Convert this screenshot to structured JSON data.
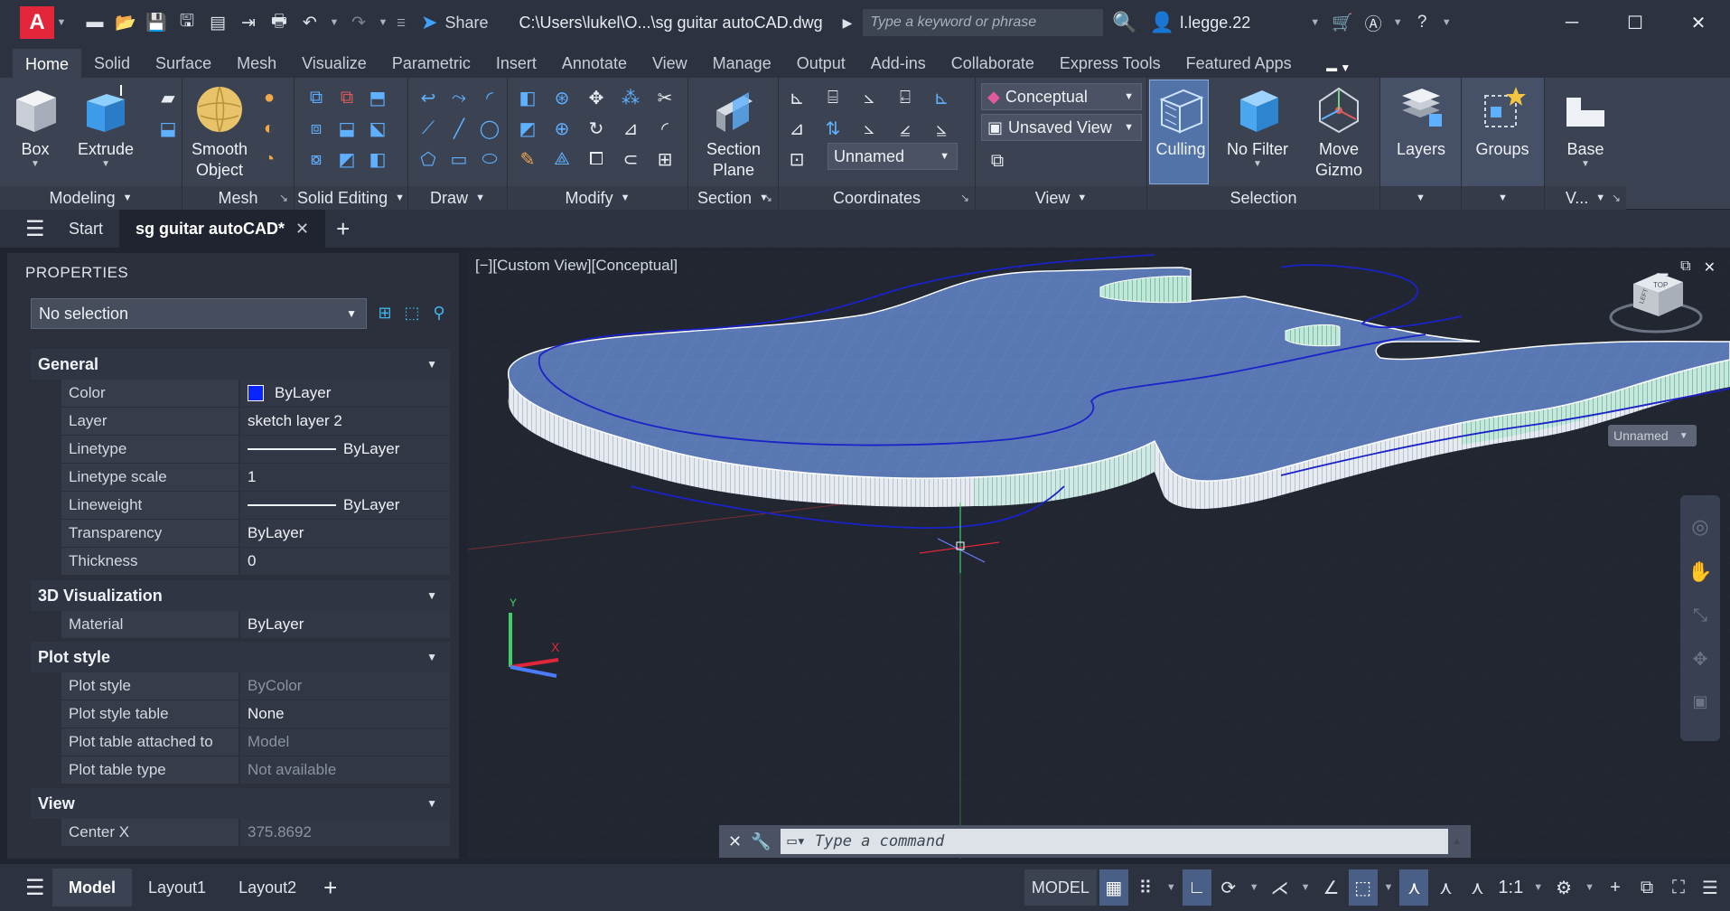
{
  "titlebar": {
    "logo": "A",
    "share": "Share",
    "filepath": "C:\\Users\\lukel\\O...\\sg guitar autoCAD.dwg",
    "search_placeholder": "Type a keyword or phrase",
    "user": "l.legge.22",
    "icons": [
      "new-icon",
      "open-icon",
      "save-icon",
      "save-as-icon",
      "print-preview-icon",
      "import-icon",
      "plot-icon",
      "undo-icon",
      "redo-icon",
      "workspace-icon"
    ]
  },
  "ribbon_tabs": [
    "Home",
    "Solid",
    "Surface",
    "Mesh",
    "Visualize",
    "Parametric",
    "Insert",
    "Annotate",
    "View",
    "Manage",
    "Output",
    "Add-ins",
    "Collaborate",
    "Express Tools",
    "Featured Apps"
  ],
  "ribbon": {
    "modeling": {
      "title": "Modeling",
      "box": "Box",
      "extrude": "Extrude"
    },
    "mesh": {
      "title": "Mesh",
      "smooth": "Smooth Object"
    },
    "solid_editing": {
      "title": "Solid Editing"
    },
    "draw": {
      "title": "Draw"
    },
    "modify": {
      "title": "Modify"
    },
    "section": {
      "title": "Section",
      "plane": "Section Plane"
    },
    "coordinates": {
      "title": "Coordinates",
      "ucs": "Unnamed"
    },
    "view": {
      "title": "View",
      "visual_style": "Conceptual",
      "saved_view": "Unsaved View"
    },
    "selection": {
      "title": "Selection",
      "culling": "Culling",
      "nofilter": "No Filter",
      "gizmo": "Move Gizmo"
    },
    "layers": {
      "label": "Layers"
    },
    "groups": {
      "label": "Groups"
    },
    "base": {
      "label": "Base",
      "title": "V..."
    }
  },
  "filetabs": {
    "start": "Start",
    "active": "sg guitar autoCAD*"
  },
  "properties": {
    "title": "PROPERTIES",
    "selection": "No selection",
    "general": {
      "title": "General",
      "rows": [
        {
          "k": "Color",
          "v": "ByLayer"
        },
        {
          "k": "Layer",
          "v": "sketch layer 2"
        },
        {
          "k": "Linetype",
          "v": "ByLayer"
        },
        {
          "k": "Linetype scale",
          "v": "1"
        },
        {
          "k": "Lineweight",
          "v": "ByLayer"
        },
        {
          "k": "Transparency",
          "v": "ByLayer"
        },
        {
          "k": "Thickness",
          "v": "0"
        }
      ]
    },
    "viz": {
      "title": "3D Visualization",
      "rows": [
        {
          "k": "Material",
          "v": "ByLayer"
        }
      ]
    },
    "plot": {
      "title": "Plot style",
      "rows": [
        {
          "k": "Plot style",
          "v": "ByColor"
        },
        {
          "k": "Plot style table",
          "v": "None"
        },
        {
          "k": "Plot table attached to",
          "v": "Model"
        },
        {
          "k": "Plot table type",
          "v": "Not available"
        }
      ]
    },
    "view": {
      "title": "View",
      "rows": [
        {
          "k": "Center X",
          "v": "375.8692"
        }
      ]
    }
  },
  "viewport": {
    "label": "[−][Custom View][Conceptual]",
    "viewcube_left": "LEFT",
    "viewcube_top": "TOP",
    "ucs_name": "Unnamed"
  },
  "command": {
    "placeholder": "Type a command"
  },
  "status": {
    "layouts": [
      "Model",
      "Layout1",
      "Layout2"
    ],
    "model": "MODEL",
    "scale": "1:1"
  },
  "colors": {
    "accent": "#5273a8",
    "solid": "#5877b3",
    "outline": "#1a22c8",
    "color_swatch": "#0a24ff"
  }
}
